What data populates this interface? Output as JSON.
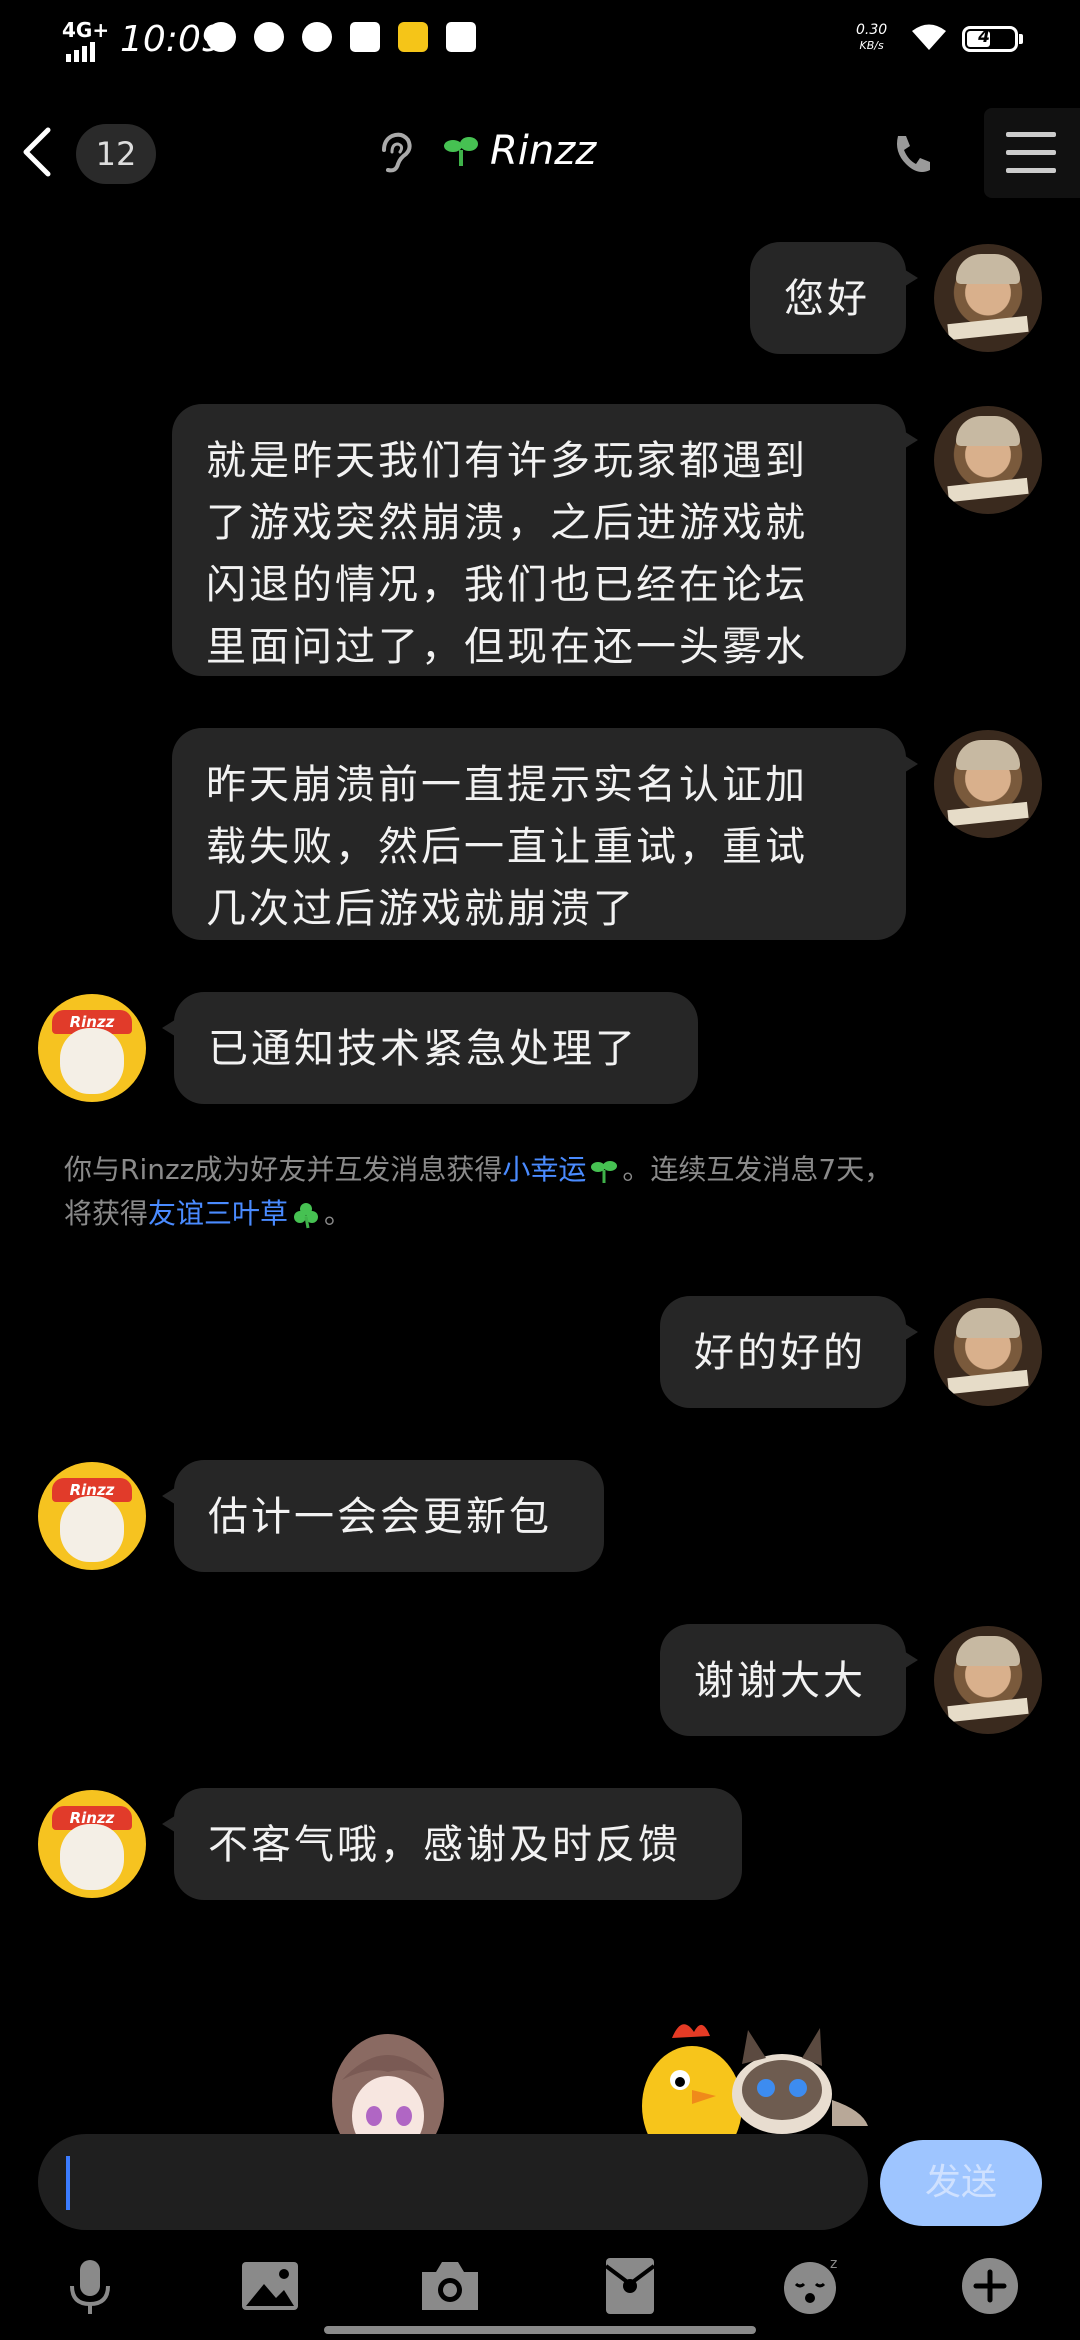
{
  "status_bar": {
    "network": "4G+",
    "time": "10:09",
    "speed_value": "0.30",
    "speed_unit": "KB/s",
    "battery": "45"
  },
  "header": {
    "unread_count": "12",
    "title": "Rinzz"
  },
  "messages": [
    {
      "side": "right",
      "text": "您好"
    },
    {
      "side": "right",
      "text": "就是昨天我们有许多玩家都遇到\n了游戏突然崩溃，之后进游戏就\n闪退的情况，我们也已经在论坛\n里面问过了，但现在还一头雾水"
    },
    {
      "side": "right",
      "text": "昨天崩溃前一直提示实名认证加\n载失败，然后一直让重试，重试\n几次过后游戏就崩溃了"
    },
    {
      "side": "left",
      "text": "已通知技术紧急处理了"
    },
    {
      "side": "right",
      "text": "好的好的"
    },
    {
      "side": "left",
      "text": "估计一会会更新包"
    },
    {
      "side": "right",
      "text": "谢谢大大"
    },
    {
      "side": "left",
      "text": "不客气哦，感谢及时反馈"
    }
  ],
  "notice": {
    "part1": "你与Rinzz成为好友并互发消息获得",
    "link1": "小幸运",
    "part2": "。连续互发消息7天，",
    "part3": "将获得",
    "link2": "友谊三叶草",
    "part4": "。"
  },
  "avatars": {
    "other_badge": "Rinzz"
  },
  "input": {
    "value": "",
    "send_label": "发送"
  },
  "toolbar": {
    "icons": [
      "microphone-icon",
      "image-icon",
      "camera-icon",
      "red-packet-icon",
      "emoji-icon",
      "plus-icon"
    ]
  },
  "colors": {
    "bubble": "#262626",
    "accent": "#4a8bff",
    "send_button": "#9ec5ff"
  }
}
